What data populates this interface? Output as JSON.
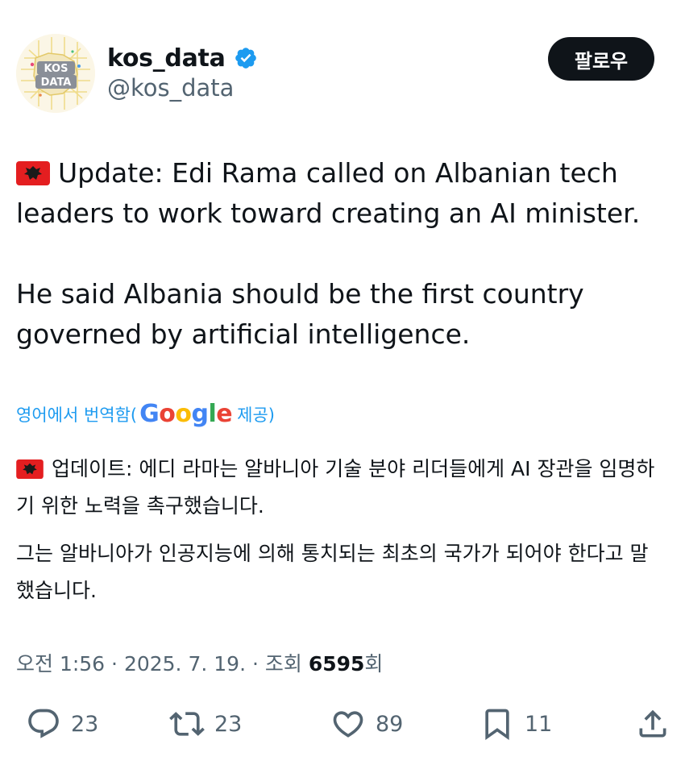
{
  "author": {
    "avatar_text": "KOS DATA",
    "display_name": "kos_data",
    "handle": "@kos_data"
  },
  "follow_button": {
    "label": "팔로우"
  },
  "tweet": {
    "paragraph1": "Update: Edi Rama called on Albanian tech leaders to work toward creating an AI minister.",
    "paragraph2": "He said Albania should be the first country governed by artificial intelligence.",
    "flag_icon": "albania-flag-icon"
  },
  "translation": {
    "prefix": "영어에서 번역함(",
    "provider": "Google",
    "suffix": "제공)",
    "paragraph1": "업데이트: 에디 라마는 알바니아 기술 분야 리더들에게 AI 장관을 임명하기 위한 노력을 촉구했습니다.",
    "paragraph2": "그는 알바니아가 인공지능에 의해 통치되는 최초의 국가가 되어야 한다고 말했습니다."
  },
  "meta": {
    "time": "오전 1:56",
    "separator": " · ",
    "date": "2025. 7. 19.",
    "views_label": "조회",
    "views_count": "6595",
    "views_suffix": "회"
  },
  "actions": {
    "reply_count": "23",
    "retweet_count": "23",
    "like_count": "89",
    "bookmark_count": "11"
  },
  "colors": {
    "text": "#0f1419",
    "secondary": "#536471",
    "link": "#1d9bf0",
    "verified": "#1d9bf0",
    "flag_red": "#e41e20"
  }
}
